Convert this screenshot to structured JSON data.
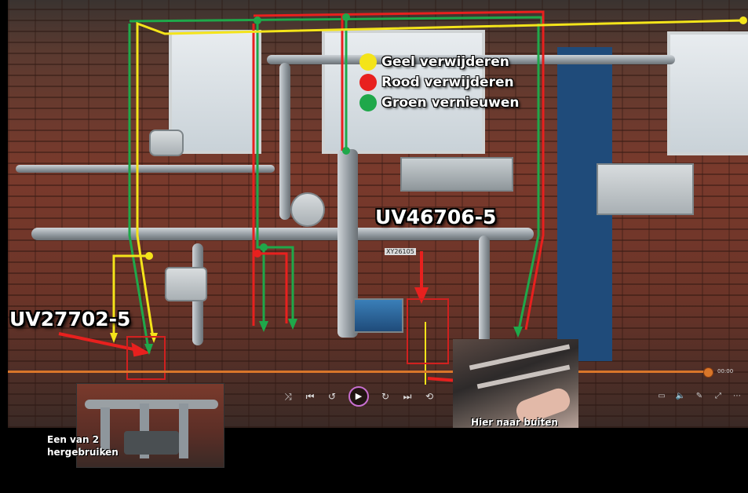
{
  "legend": [
    {
      "color": "#f4e41a",
      "label": "Geel verwijderen"
    },
    {
      "color": "#e8201e",
      "label": "Rood verwijderen"
    },
    {
      "color": "#1fa84a",
      "label": "Groen vernieuwen"
    }
  ],
  "labels": {
    "uv46706": "UV46706-5",
    "uv27702": "UV27702-5",
    "hier_naar_buiten": "Hier naar buiten",
    "een_van_2_line1": "Een van 2",
    "een_van_2_line2": "hergebruiken",
    "valve_tag": "XY26105"
  },
  "player": {
    "time": "00:00",
    "progress_fraction": 0.99
  },
  "colors": {
    "yellow": "#f4e41a",
    "red": "#e8201e",
    "green": "#1fa84a",
    "accent": "#d9762a"
  }
}
